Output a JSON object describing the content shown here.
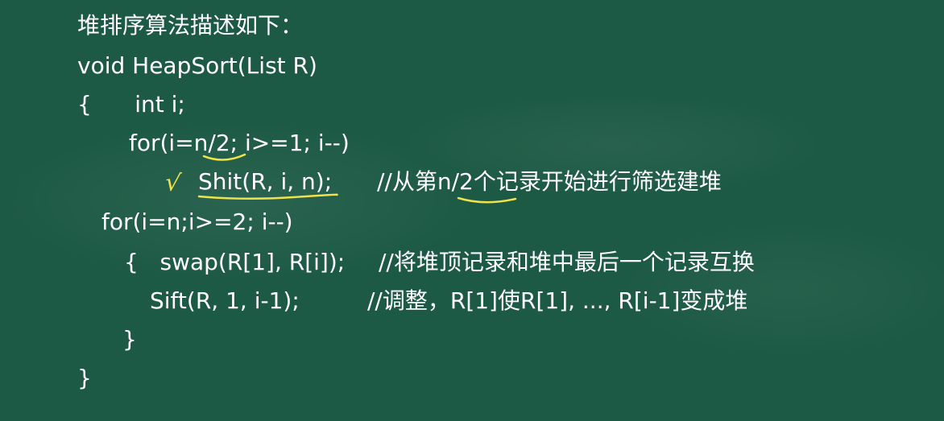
{
  "slide": {
    "title": "堆排序算法描述如下：",
    "lines": [
      "void HeapSort(List R)",
      "{      int i;",
      "for(i=n/2; i>=1; i--)",
      "Shit(R, i, n);",
      "//从第n/2个记录开始进行筛选建堆",
      "for(i=n;i>=2; i--)",
      "{   swap(R[1], R[i]);",
      "//将堆顶记录和堆中最后一个记录互换",
      "Sift(R, 1, i-1);",
      "//调整，R[1]使R[1], ..., R[i-1]变成堆",
      "}",
      "}"
    ]
  },
  "annotations": {
    "check_mark": "√",
    "color": "#f2e24a"
  },
  "colors": {
    "background": "#1d5a45",
    "text": "#ffffff",
    "highlight": "#f2e24a"
  }
}
